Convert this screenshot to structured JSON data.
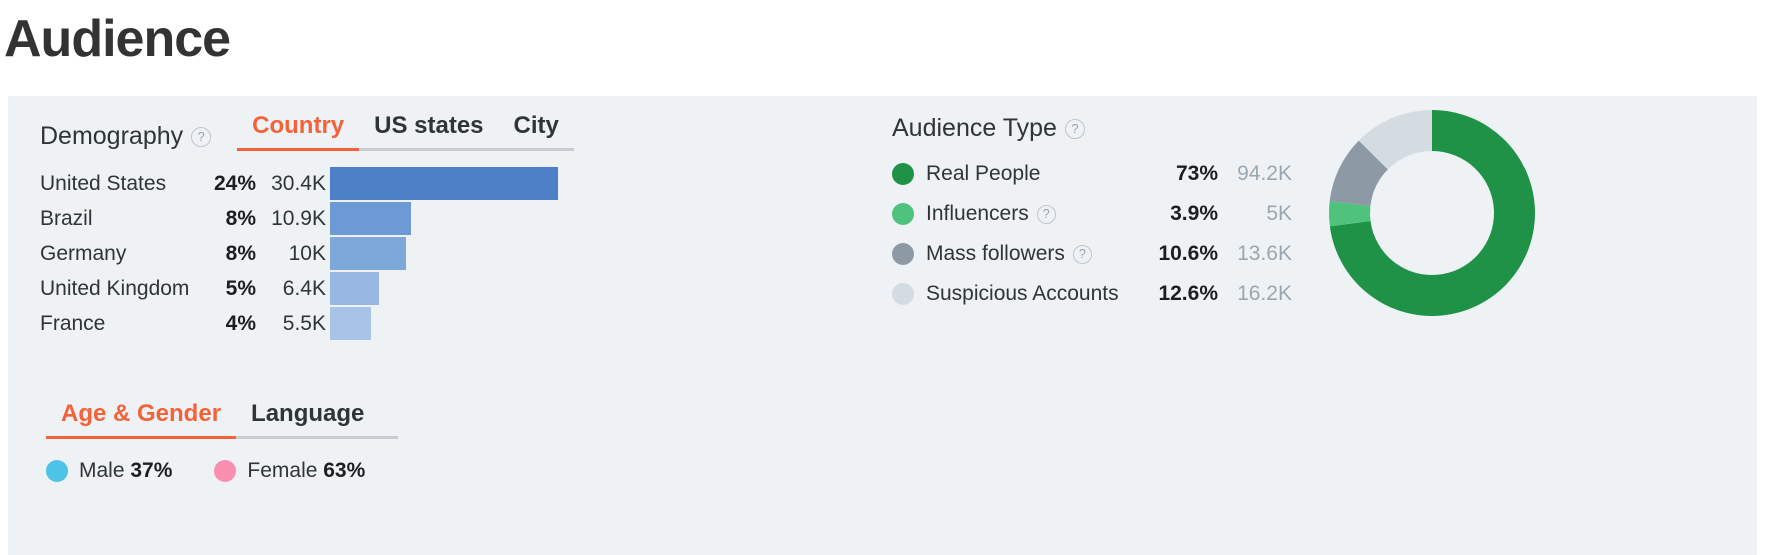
{
  "page": {
    "title": "Audience"
  },
  "demography": {
    "label": "Demography",
    "help_icon": "question-mark-icon",
    "tabs": [
      {
        "label": "Country",
        "active": true
      },
      {
        "label": "US states",
        "active": false
      },
      {
        "label": "City",
        "active": false
      }
    ],
    "countries": [
      {
        "name": "United States",
        "percent": "24%",
        "value": "30.4K",
        "bar_pct": 100,
        "color": "#4e80c8"
      },
      {
        "name": "Brazil",
        "percent": "8%",
        "value": "10.9K",
        "bar_pct": 35.6,
        "color": "#6d99d4"
      },
      {
        "name": "Germany",
        "percent": "8%",
        "value": "10K",
        "bar_pct": 33.4,
        "color": "#7ea8da"
      },
      {
        "name": "United Kingdom",
        "percent": "5%",
        "value": "6.4K",
        "bar_pct": 21.4,
        "color": "#96b8e2"
      },
      {
        "name": "France",
        "percent": "4%",
        "value": "5.5K",
        "bar_pct": 17.8,
        "color": "#a7c3e8"
      }
    ]
  },
  "age_gender": {
    "tabs": [
      {
        "label": "Age & Gender",
        "active": true
      },
      {
        "label": "Language",
        "active": false
      }
    ],
    "legend": [
      {
        "label": "Male",
        "percent": "37%",
        "color": "#4ec3e8"
      },
      {
        "label": "Female",
        "percent": "63%",
        "color": "#f98fb0"
      }
    ]
  },
  "audience_type": {
    "label": "Audience Type",
    "help_icon": "question-mark-icon",
    "rows": [
      {
        "label": "Real People",
        "percent": "73%",
        "count": "94.2K",
        "color": "#1f9247",
        "has_help": false
      },
      {
        "label": "Influencers",
        "percent": "3.9%",
        "count": "5K",
        "color": "#4fc27e",
        "has_help": true
      },
      {
        "label": "Mass followers",
        "percent": "10.6%",
        "count": "13.6K",
        "color": "#8d9aa5",
        "has_help": true
      },
      {
        "label": "Suspicious Accounts",
        "percent": "12.6%",
        "count": "16.2K",
        "color": "#d5dce1",
        "has_help": false
      }
    ]
  },
  "chart_data": [
    {
      "type": "bar",
      "title": "Country",
      "orientation": "horizontal",
      "categories": [
        "United States",
        "Brazil",
        "Germany",
        "United Kingdom",
        "France"
      ],
      "values": [
        30400,
        10900,
        10000,
        6400,
        5500
      ],
      "percents": [
        24,
        8,
        8,
        5,
        4
      ],
      "value_labels": [
        "30.4K",
        "10.9K",
        "10K",
        "6.4K",
        "5.5K"
      ],
      "percent_labels": [
        "24%",
        "8%",
        "8%",
        "5%",
        "4%"
      ],
      "xlabel": "",
      "ylabel": "",
      "grid": false,
      "legend": "none"
    },
    {
      "type": "pie",
      "title": "Audience Type",
      "donut": true,
      "categories": [
        "Real People",
        "Influencers",
        "Mass followers",
        "Suspicious Accounts"
      ],
      "values": [
        73,
        3.9,
        10.6,
        12.6
      ],
      "value_labels": [
        "73%",
        "3.9%",
        "10.6%",
        "12.6%"
      ],
      "counts": [
        "94.2K",
        "5K",
        "13.6K",
        "16.2K"
      ],
      "colors": [
        "#1f9247",
        "#4fc27e",
        "#8d9aa5",
        "#d5dce1"
      ],
      "legend": "left"
    },
    {
      "type": "pie",
      "title": "Age & Gender",
      "categories": [
        "Male",
        "Female"
      ],
      "values": [
        37,
        63
      ],
      "value_labels": [
        "37%",
        "63%"
      ],
      "colors": [
        "#4ec3e8",
        "#f98fb0"
      ],
      "legend": "bottom"
    }
  ],
  "theme": {
    "accent": "#f4623a",
    "panel_bg": "#eef2f5",
    "page_bg": "#ffffff",
    "title_color": "#333333"
  }
}
